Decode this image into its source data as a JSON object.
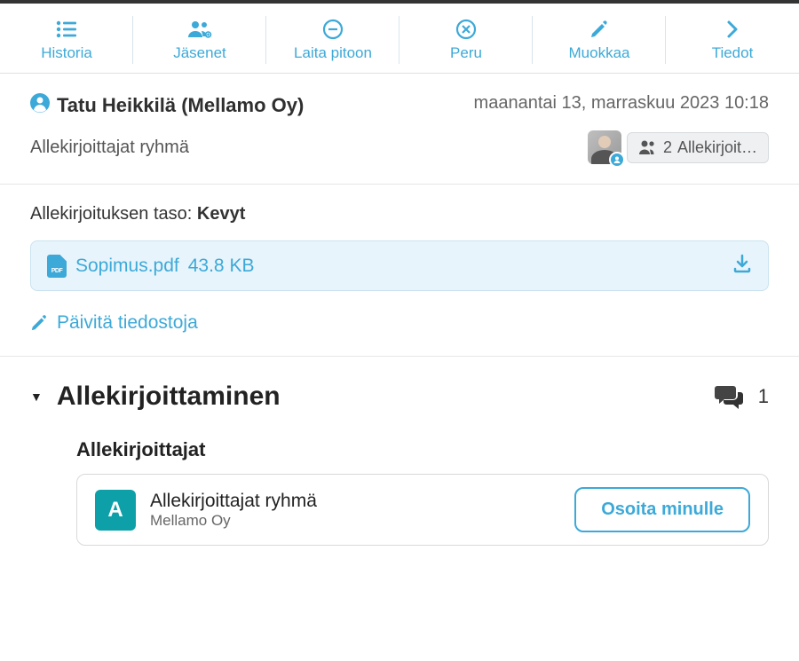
{
  "toolbar": [
    {
      "label": "Historia",
      "icon": "list"
    },
    {
      "label": "Jäsenet",
      "icon": "members"
    },
    {
      "label": "Laita pitoon",
      "icon": "hold"
    },
    {
      "label": "Peru",
      "icon": "cancel"
    },
    {
      "label": "Muokkaa",
      "icon": "edit"
    },
    {
      "label": "Tiedot",
      "icon": "chevron"
    }
  ],
  "header": {
    "user_name": "Tatu Heikkilä (Mellamo Oy)",
    "subtitle": "Allekirjoittajat ryhmä",
    "timestamp": "maanantai 13, marraskuu 2023 10:18",
    "group_count": "2",
    "group_label": "Allekirjoit…"
  },
  "level": {
    "label": "Allekirjoituksen taso:",
    "value": "Kevyt"
  },
  "file": {
    "pdf_badge": "PDF",
    "name": "Sopimus.pdf",
    "size": "43.8 KB"
  },
  "update_link": "Päivitä tiedostoja",
  "signing": {
    "title": "Allekirjoittaminen",
    "comment_count": "1",
    "signers_title": "Allekirjoittajat",
    "signer": {
      "initial": "A",
      "name": "Allekirjoittajat ryhmä",
      "org": "Mellamo Oy"
    },
    "assign_label": "Osoita minulle"
  }
}
